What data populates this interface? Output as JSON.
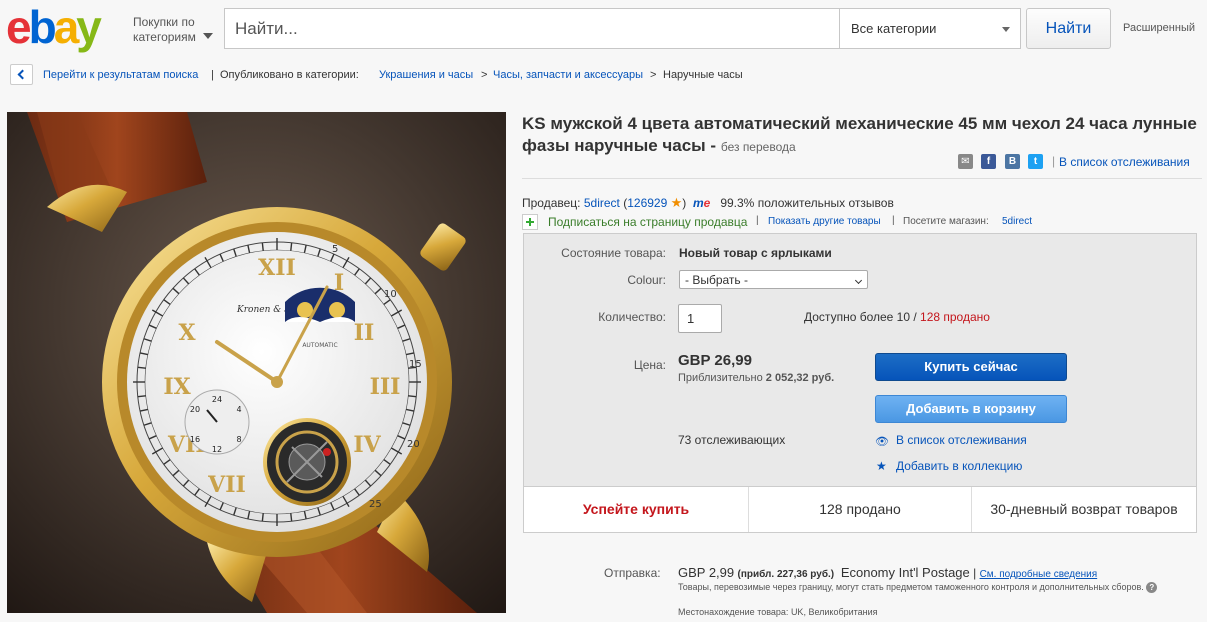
{
  "header": {
    "shop_by": [
      "Покупки по",
      "категориям"
    ],
    "search_placeholder": "Найти...",
    "category": "Все категории",
    "search_button": "Найти",
    "advanced": "Расширенный"
  },
  "breadcrumb": {
    "back_to_results": "Перейти к результатам поиска",
    "published_in": "Опубликовано в категории:",
    "items": [
      "Украшения и часы",
      "Часы, запчасти и аксессуары",
      "Наручные часы"
    ]
  },
  "item": {
    "title": "KS мужской 4 цвета автоматический механические 45 мм чехол 24 часа лунные фазы наручные часы -",
    "title_suffix": "без перевода",
    "watchlist_link": "В список отслеживания",
    "share_icons": [
      "email-icon",
      "facebook-icon",
      "vk-icon",
      "twitter-icon"
    ]
  },
  "seller": {
    "label": "Продавец:",
    "name": "5direct",
    "feedback_count": "126929",
    "feedback_pct": "99.3%",
    "feedback_text": "положительных отзывов",
    "subscribe": "Подписаться на страницу продавца",
    "other_items": "Показать другие товары",
    "visit_store_label": "Посетите магазин:",
    "store_name": "5direct"
  },
  "panel": {
    "condition_label": "Состояние товара:",
    "condition_value": "Новый товар с ярлыками",
    "colour_label": "Colour:",
    "colour_value": "- Выбрать -",
    "quantity_label": "Количество:",
    "quantity_value": "1",
    "available": "Доступно более 10 /",
    "sold": "128 продано",
    "price_label": "Цена:",
    "price": "GBP 26,99",
    "approx_label": "Приблизительно",
    "approx_value": "2 052,32 руб.",
    "buy_now": "Купить сейчас",
    "add_to_cart": "Добавить в корзину",
    "watchers": "73 отслеживающих",
    "add_watchlist": "В список отслеживания",
    "add_collection": "Добавить в коллекцию",
    "bottom": [
      "Успейте купить",
      "128 продано",
      "30-дневный возврат товаров"
    ]
  },
  "shipping": {
    "label": "Отправка:",
    "price": "GBP 2,99",
    "approx": "(прибл. 227,36 руб.)",
    "method": "Economy Int'l Postage",
    "details_link": "См. подробные сведения",
    "note": "Товары, перевозимые через границу, могут стать предметом таможенного контроля и дополнительных сборов.",
    "location_label": "Местонахождение товара:",
    "location": "UK, Великобритания"
  },
  "watch_dial": {
    "brand": "Kronen & Söhne",
    "automatic": "AUTOMATIC",
    "sub_numbers": [
      "24",
      "4",
      "8",
      "12",
      "16",
      "20"
    ],
    "minute_numbers": [
      "5",
      "10",
      "15",
      "20",
      "25"
    ]
  },
  "colors": {
    "link": "#0654ba",
    "buy_now": "#0654ba",
    "cart": "#4a97e3",
    "sold_red": "#c4161c"
  }
}
